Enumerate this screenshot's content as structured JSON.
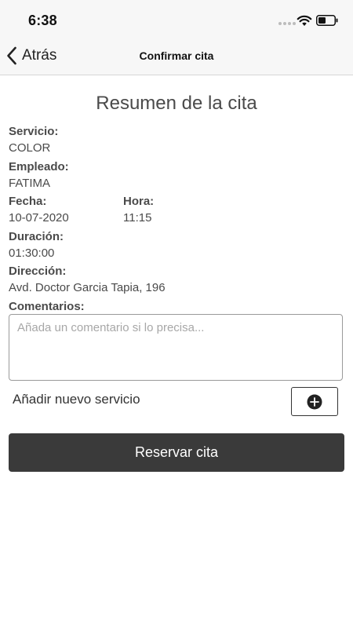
{
  "status_bar": {
    "time": "6:38"
  },
  "nav": {
    "back_label": "Atrás",
    "title": "Confirmar cita"
  },
  "summary": {
    "title": "Resumen de la cita",
    "service_label": "Servicio:",
    "service_value": "COLOR",
    "employee_label": "Empleado:",
    "employee_value": "FATIMA",
    "date_label": "Fecha:",
    "date_value": "10-07-2020",
    "time_label": "Hora:",
    "time_value": "11:15",
    "duration_label": "Duración:",
    "duration_value": "01:30:00",
    "address_label": "Dirección:",
    "address_value": "Avd. Doctor Garcia Tapia, 196",
    "comments_label": "Comentarios:",
    "comments_placeholder": "Añada un comentario si lo precisa...",
    "comments_value": ""
  },
  "add_service": {
    "label": "Añadir nuevo servicio"
  },
  "reserve_button": {
    "label": "Reservar cita"
  },
  "icons": {
    "back": "chevron-left-icon",
    "wifi": "wifi-icon",
    "battery": "battery-icon",
    "signal": "signal-dots-icon",
    "add": "plus-circle-icon"
  },
  "colors": {
    "text": "#4a4a4a",
    "button_bg": "#3a3a3a",
    "bar_bg": "#f7f7f7"
  }
}
